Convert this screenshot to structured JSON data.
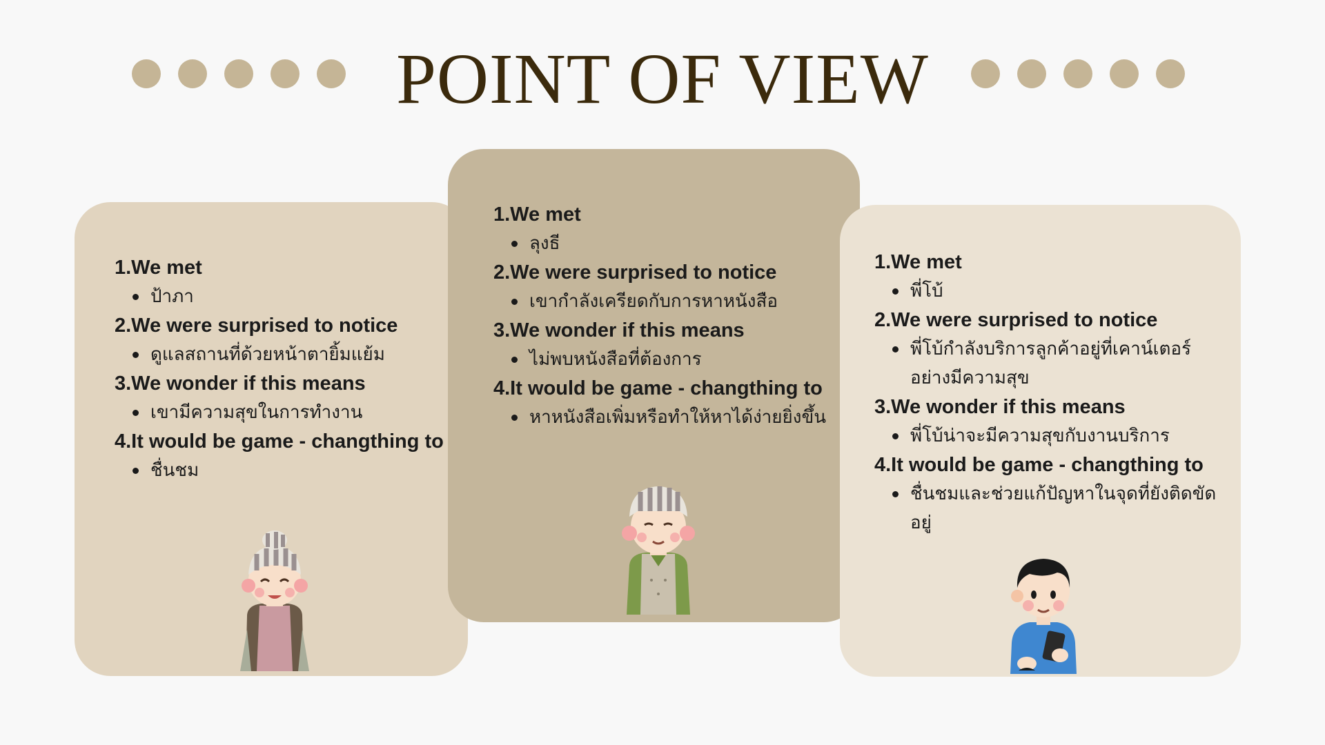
{
  "header": {
    "title": "POINT OF VIEW",
    "dot_color": "#c5b596",
    "left_dots": 5,
    "right_dots": 5
  },
  "cards": [
    {
      "q1": "1.We met",
      "a1": "ป้าภา",
      "q2": "2.We were surprised to notice",
      "a2": "ดูแลสถานที่ด้วยหน้าตายิ้มแย้ม",
      "q3": "3.We wonder if this means",
      "a3": "เขามีความสุขในการทำงาน",
      "q4": "4.It would be game - changthing to",
      "a4": "ชื่นชม",
      "illustration": "elderly-woman-icon",
      "bg": "#e1d4bf"
    },
    {
      "q1": "1.We met",
      "a1": "ลุงธี",
      "q2": "2.We were surprised to notice",
      "a2": "เขากำลังเครียดกับการหาหนังสือ",
      "q3": "3.We wonder if this means",
      "a3": "ไม่พบหนังสือที่ต้องการ",
      "q4": "4.It would be game - changthing to",
      "a4": "หาหนังสือเพิ่มหรือทำให้หาได้ง่ายยิ่งขึ้น",
      "illustration": "elderly-man-icon",
      "bg": "#c4b69b"
    },
    {
      "q1": "1.We met",
      "a1": "พี่โบ้",
      "q2": "2.We were surprised to notice",
      "a2": "พี่โบ้กำลังบริการลูกค้าอยู่ที่เคาน์เตอร์อย่างมีความสุข",
      "q3": "3.We wonder if this means",
      "a3": "พี่โบ้น่าจะมีความสุขกับงานบริการ",
      "q4": "4.It would be game - changthing to",
      "a4": "ชื่นชมและช่วยแก้ปัญหาในจุดที่ยังติดขัดอยู่",
      "illustration": "young-man-with-phone-icon",
      "bg": "#ebe2d3"
    }
  ]
}
